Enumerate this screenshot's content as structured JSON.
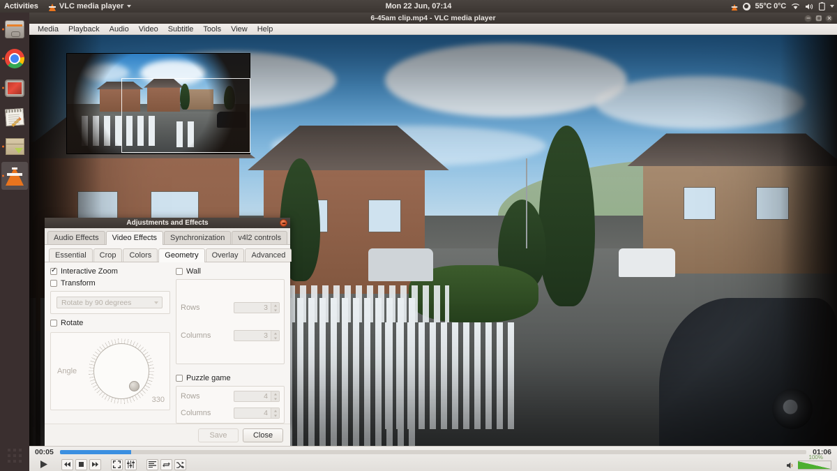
{
  "desktop": {
    "activities": "Activities",
    "app_menu": "VLC media player",
    "clock": "Mon 22 Jun, 07:14",
    "tray": {
      "temperature": "55°C 0°C",
      "icons": [
        "vlc-cone-icon",
        "thermometer-icon",
        "wifi-icon",
        "volume-icon",
        "battery-icon",
        "caret-down-icon"
      ]
    },
    "launcher": [
      {
        "name": "files",
        "label": "Files"
      },
      {
        "name": "chrome",
        "label": "Google Chrome"
      },
      {
        "name": "video-editor",
        "label": "Video Editor"
      },
      {
        "name": "text-editor",
        "label": "Text Editor"
      },
      {
        "name": "software-center",
        "label": "Ubuntu Software"
      },
      {
        "name": "vlc",
        "label": "VLC media player"
      }
    ],
    "app_grid_label": "Show Applications"
  },
  "window": {
    "title": "6-45am clip.mp4 - VLC media player",
    "controls": [
      "minimize",
      "maximize",
      "close"
    ],
    "menubar": [
      "Media",
      "Playback",
      "Audio",
      "Video",
      "Subtitle",
      "Tools",
      "View",
      "Help"
    ]
  },
  "dialog": {
    "title": "Adjustments and Effects",
    "close_label": "Close dialog",
    "tabs": [
      {
        "label": "Audio Effects",
        "active": false
      },
      {
        "label": "Video Effects",
        "active": true
      },
      {
        "label": "Synchronization",
        "active": false
      },
      {
        "label": "v4l2 controls",
        "active": false
      }
    ],
    "subtabs": [
      {
        "label": "Essential",
        "active": false
      },
      {
        "label": "Crop",
        "active": false
      },
      {
        "label": "Colors",
        "active": false
      },
      {
        "label": "Geometry",
        "active": true
      },
      {
        "label": "Overlay",
        "active": false
      },
      {
        "label": "Advanced",
        "active": false
      }
    ],
    "geometry": {
      "interactive_zoom": {
        "label": "Interactive Zoom",
        "checked": true
      },
      "transform": {
        "label": "Transform",
        "checked": false,
        "combo_value": "Rotate by 90 degrees"
      },
      "rotate": {
        "label": "Rotate",
        "checked": false,
        "angle_label": "Angle",
        "angle_value": "330"
      },
      "wall": {
        "label": "Wall",
        "checked": false,
        "rows_label": "Rows",
        "rows_value": "3",
        "columns_label": "Columns",
        "columns_value": "3"
      },
      "puzzle": {
        "label": "Puzzle game",
        "checked": false,
        "rows_label": "Rows",
        "rows_value": "4",
        "columns_label": "Columns",
        "columns_value": "4"
      }
    },
    "buttons": {
      "save": "Save",
      "close": "Close"
    }
  },
  "player": {
    "elapsed": "00:05",
    "total": "01:06",
    "progress_percent": 9.5,
    "volume_percent": "100%",
    "controls": [
      {
        "name": "play-button",
        "label": "Play"
      },
      {
        "name": "previous-button",
        "label": "Previous"
      },
      {
        "name": "stop-button",
        "label": "Stop"
      },
      {
        "name": "next-button",
        "label": "Next"
      },
      {
        "name": "fullscreen-button",
        "label": "Toggle fullscreen"
      },
      {
        "name": "extended-settings-button",
        "label": "Show extended settings"
      },
      {
        "name": "playlist-button",
        "label": "Show playlist"
      },
      {
        "name": "loop-button",
        "label": "Loop"
      },
      {
        "name": "shuffle-button",
        "label": "Random"
      }
    ]
  },
  "video": {
    "description": "Fisheye doorbell camera view of a suburban street with houses, white picket fence and parked cars",
    "zoom_overlay_label": "Interactive zoom thumbnail"
  }
}
